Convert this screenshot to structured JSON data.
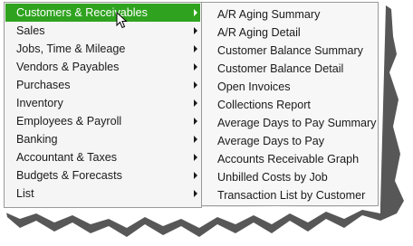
{
  "left_menu": {
    "items": [
      {
        "label": "Customers & Receivables",
        "highlighted": true,
        "has_submenu": true
      },
      {
        "label": "Sales",
        "has_submenu": true
      },
      {
        "label": "Jobs, Time & Mileage",
        "has_submenu": true
      },
      {
        "label": "Vendors & Payables",
        "has_submenu": true
      },
      {
        "label": "Purchases",
        "has_submenu": true
      },
      {
        "label": "Inventory",
        "has_submenu": true
      },
      {
        "label": "Employees & Payroll",
        "has_submenu": true
      },
      {
        "label": "Banking",
        "has_submenu": true
      },
      {
        "label": "Accountant & Taxes",
        "has_submenu": true
      },
      {
        "label": "Budgets & Forecasts",
        "has_submenu": true
      },
      {
        "label": "List",
        "has_submenu": true
      }
    ]
  },
  "submenu": {
    "items": [
      {
        "label": "A/R Aging Summary"
      },
      {
        "label": "A/R Aging Detail"
      },
      {
        "label": "Customer Balance Summary"
      },
      {
        "label": "Customer Balance Detail"
      },
      {
        "label": "Open Invoices"
      },
      {
        "label": "Collections Report"
      },
      {
        "label": "Average Days to Pay Summary"
      },
      {
        "label": "Average Days to Pay"
      },
      {
        "label": "Accounts Receivable Graph"
      },
      {
        "label": "Unbilled Costs by Job"
      },
      {
        "label": "Transaction List by Customer"
      }
    ]
  },
  "colors": {
    "highlight": "#2fa31f",
    "menu_bg": "#f5f5f5",
    "text": "#1a1a1a"
  }
}
